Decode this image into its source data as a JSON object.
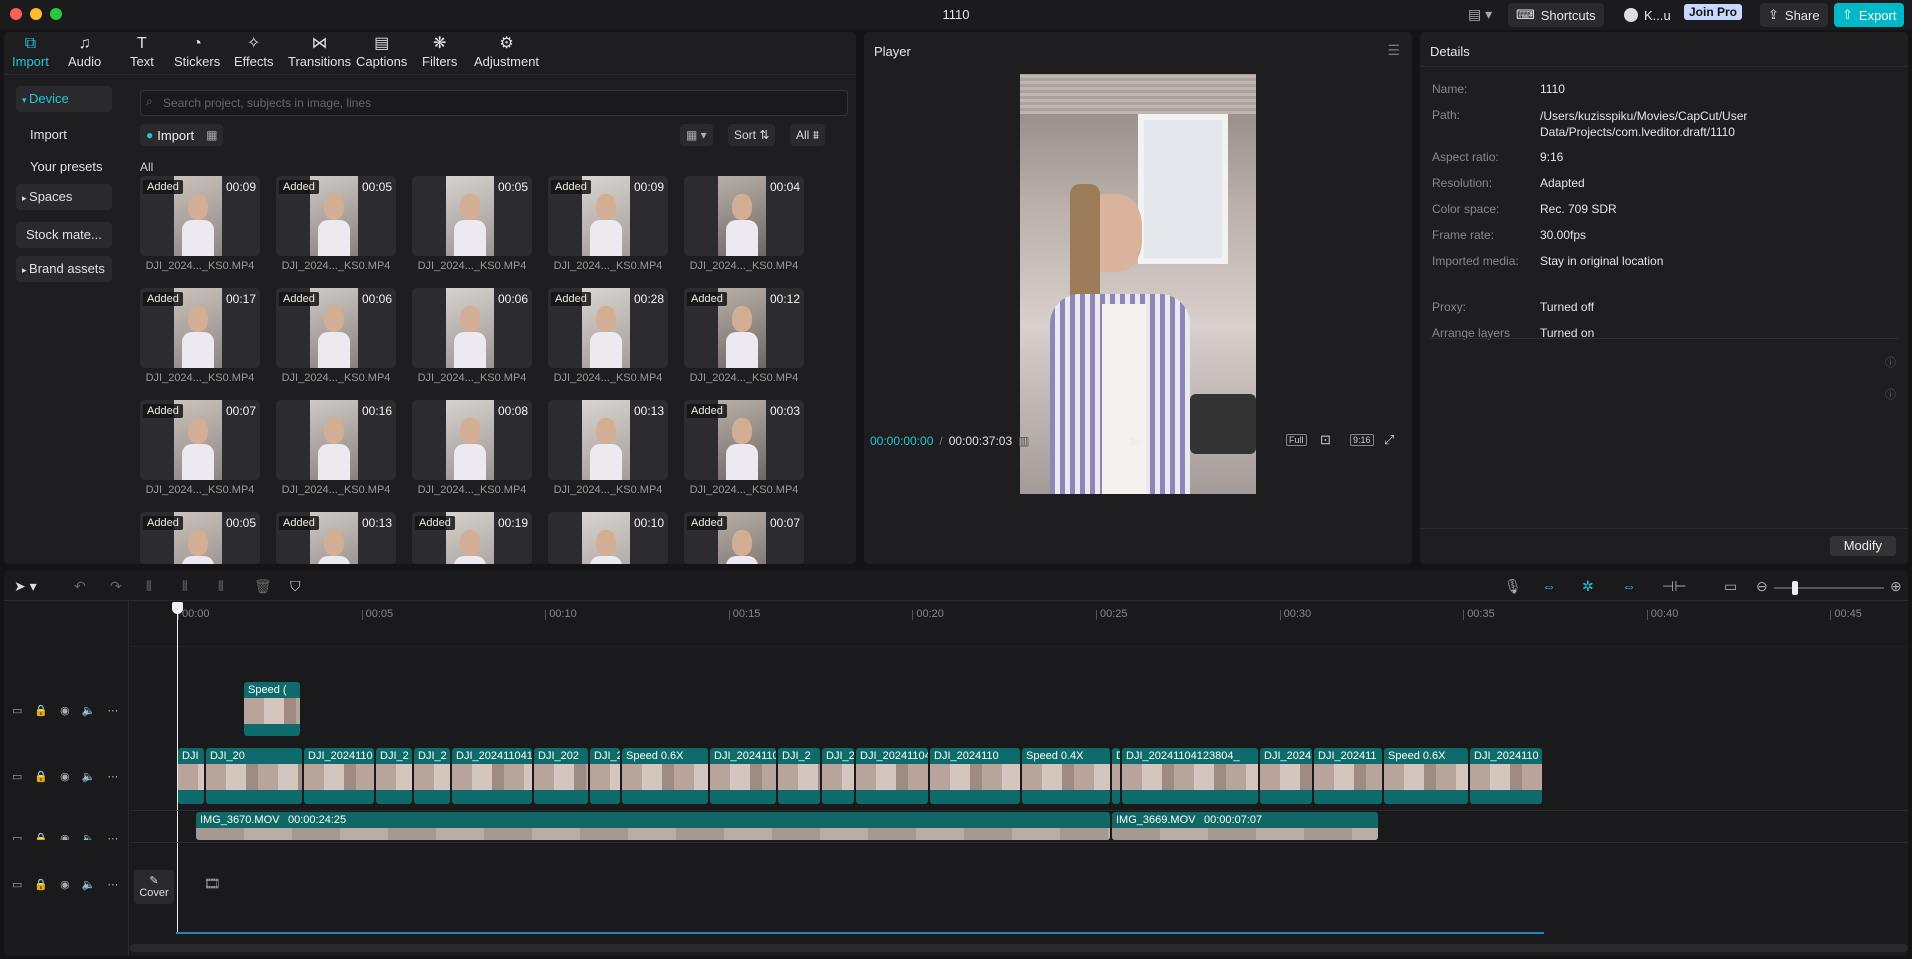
{
  "window": {
    "title": "1110"
  },
  "titlebar": {
    "shortcuts_label": "Shortcuts",
    "account_label": "K...u",
    "join_pro_label": "Join Pro",
    "share_label": "Share",
    "export_label": "Export"
  },
  "tabs": [
    {
      "label": "Import",
      "icon": "import-icon"
    },
    {
      "label": "Audio",
      "icon": "audio-icon"
    },
    {
      "label": "Text",
      "icon": "text-icon"
    },
    {
      "label": "Stickers",
      "icon": "stickers-icon"
    },
    {
      "label": "Effects",
      "icon": "effects-icon"
    },
    {
      "label": "Transitions",
      "icon": "transitions-icon"
    },
    {
      "label": "Captions",
      "icon": "captions-icon"
    },
    {
      "label": "Filters",
      "icon": "filters-icon"
    },
    {
      "label": "Adjustment",
      "icon": "adjustment-icon"
    }
  ],
  "sidebar": {
    "items": [
      {
        "label": "Device"
      },
      {
        "label": "Import"
      },
      {
        "label": "Your presets"
      },
      {
        "label": "Spaces"
      },
      {
        "label": "Stock mate..."
      },
      {
        "label": "Brand assets"
      }
    ]
  },
  "media": {
    "search_placeholder": "Search project, subjects in image, lines",
    "import_label": "Import",
    "sort_label": "Sort",
    "filter_label": "All",
    "section_label": "All",
    "added_label": "Added",
    "items": [
      {
        "name": "DJI_2024..._KS0.MP4",
        "duration": "00:09",
        "added": true
      },
      {
        "name": "DJI_2024..._KS0.MP4",
        "duration": "00:05",
        "added": true
      },
      {
        "name": "DJI_2024..._KS0.MP4",
        "duration": "00:05",
        "added": false
      },
      {
        "name": "DJI_2024..._KS0.MP4",
        "duration": "00:09",
        "added": true
      },
      {
        "name": "DJI_2024..._KS0.MP4",
        "duration": "00:04",
        "added": false
      },
      {
        "name": "DJI_2024..._KS0.MP4",
        "duration": "00:17",
        "added": true
      },
      {
        "name": "DJI_2024..._KS0.MP4",
        "duration": "00:06",
        "added": true
      },
      {
        "name": "DJI_2024..._KS0.MP4",
        "duration": "00:06",
        "added": false
      },
      {
        "name": "DJI_2024..._KS0.MP4",
        "duration": "00:28",
        "added": true
      },
      {
        "name": "DJI_2024..._KS0.MP4",
        "duration": "00:12",
        "added": true
      },
      {
        "name": "DJI_2024..._KS0.MP4",
        "duration": "00:07",
        "added": true
      },
      {
        "name": "DJI_2024..._KS0.MP4",
        "duration": "00:16",
        "added": false
      },
      {
        "name": "DJI_2024..._KS0.MP4",
        "duration": "00:08",
        "added": false
      },
      {
        "name": "DJI_2024..._KS0.MP4",
        "duration": "00:13",
        "added": false
      },
      {
        "name": "DJI_2024..._KS0.MP4",
        "duration": "00:03",
        "added": true
      },
      {
        "name": "",
        "duration": "00:05",
        "added": true
      },
      {
        "name": "",
        "duration": "00:13",
        "added": true
      },
      {
        "name": "",
        "duration": "00:19",
        "added": true
      },
      {
        "name": "",
        "duration": "00:10",
        "added": false
      },
      {
        "name": "",
        "duration": "00:07",
        "added": true
      }
    ]
  },
  "player": {
    "title": "Player",
    "current_time": "00:00:00:00",
    "separator": "/",
    "total_time": "00:00:37:03",
    "full_label": "Full",
    "ratio_label": "9:16"
  },
  "details": {
    "title": "Details",
    "rows": [
      {
        "label": "Name:",
        "value": "1110"
      },
      {
        "label": "Path:",
        "value": "/Users/kuzisspiku/Movies/CapCut/User Data/Projects/com.lveditor.draft/1110"
      },
      {
        "label": "Aspect ratio:",
        "value": "9:16"
      },
      {
        "label": "Resolution:",
        "value": "Adapted"
      },
      {
        "label": "Color space:",
        "value": "Rec. 709 SDR"
      },
      {
        "label": "Frame rate:",
        "value": "30.00fps"
      },
      {
        "label": "Imported media:",
        "value": "Stay in original location"
      },
      {
        "label": "Proxy:",
        "value": "Turned off"
      },
      {
        "label": "Arrange layers",
        "value": "Turned on"
      }
    ],
    "modify_label": "Modify"
  },
  "timeline": {
    "ruler": [
      "00:00",
      "00:05",
      "00:10",
      "00:15",
      "00:20",
      "00:25",
      "00:30",
      "00:35",
      "00:40",
      "00:45"
    ],
    "overlay_clip_label": "Speed (",
    "main_clips": [
      {
        "label": "DJI"
      },
      {
        "label": "DJI_20"
      },
      {
        "label": "DJI_2024110"
      },
      {
        "label": "DJI_2"
      },
      {
        "label": "DJI_2"
      },
      {
        "label": "DJI_2024110412"
      },
      {
        "label": "DJI_202"
      },
      {
        "label": "DJI_2"
      },
      {
        "label": "Speed 0.6X"
      },
      {
        "label": "DJI_2024110"
      },
      {
        "label": "DJI_2"
      },
      {
        "label": "DJI_2"
      },
      {
        "label": "DJI_20241104"
      },
      {
        "label": "DJI_2024110"
      },
      {
        "label": "Speed 0.4X"
      },
      {
        "label": "D"
      },
      {
        "label": "DJI_20241104123804_"
      },
      {
        "label": "DJI_2024"
      },
      {
        "label": "DJI_202411"
      },
      {
        "label": "Speed 0.6X"
      },
      {
        "label": "DJI_2024110"
      }
    ],
    "audio_clips": [
      {
        "name": "IMG_3670.MOV",
        "duration": "00:00:24:25"
      },
      {
        "name": "IMG_3669.MOV",
        "duration": "00:00:07:07"
      }
    ],
    "cover_label": "Cover"
  }
}
